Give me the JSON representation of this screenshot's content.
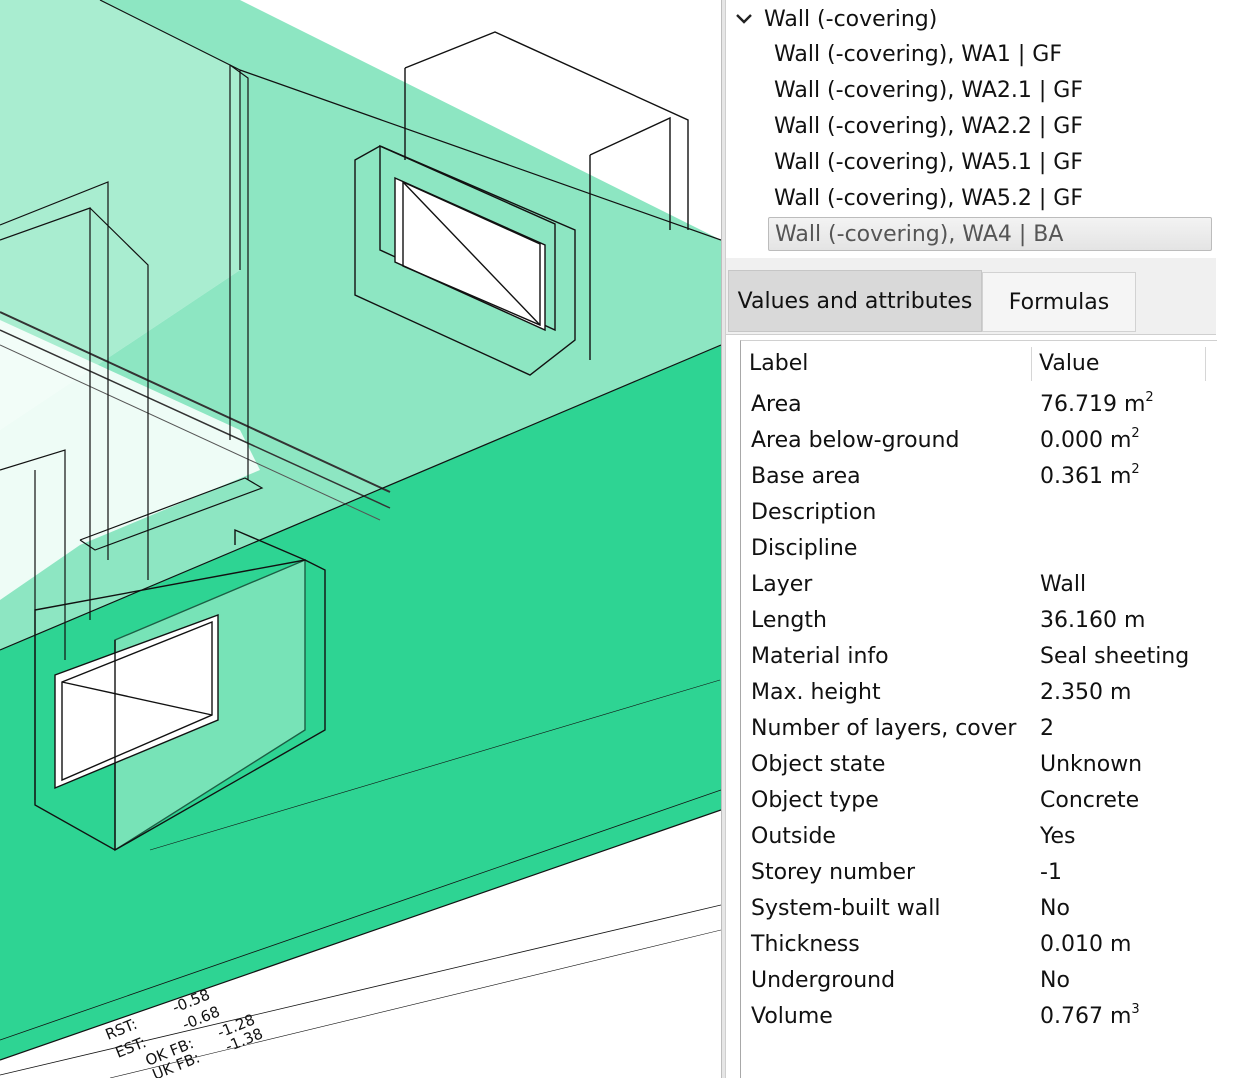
{
  "tree": {
    "root_label": "Wall (-covering)",
    "items": [
      {
        "label": "Wall (-covering), WA1 | GF",
        "selected": false
      },
      {
        "label": "Wall (-covering), WA2.1 | GF",
        "selected": false
      },
      {
        "label": "Wall (-covering), WA2.2 | GF",
        "selected": false
      },
      {
        "label": "Wall (-covering), WA5.1 | GF",
        "selected": false
      },
      {
        "label": "Wall (-covering), WA5.2 | GF",
        "selected": false
      },
      {
        "label": "Wall (-covering), WA4 | BA",
        "selected": true
      }
    ]
  },
  "tabs": {
    "values_label": "Values and attributes",
    "formulas_label": "Formulas"
  },
  "grid": {
    "header_label": "Label",
    "header_value": "Value",
    "rows": [
      {
        "label": "Area",
        "value": "76.719 m",
        "sup": "2"
      },
      {
        "label": "Area below-ground",
        "value": "0.000 m",
        "sup": "2"
      },
      {
        "label": "Base area",
        "value": "0.361 m",
        "sup": "2"
      },
      {
        "label": "Description",
        "value": "",
        "sup": ""
      },
      {
        "label": "Discipline",
        "value": "",
        "sup": ""
      },
      {
        "label": "Layer",
        "value": "Wall",
        "sup": ""
      },
      {
        "label": "Length",
        "value": "36.160 m",
        "sup": ""
      },
      {
        "label": "Material info",
        "value": "Seal sheeting",
        "sup": ""
      },
      {
        "label": "Max. height",
        "value": "2.350 m",
        "sup": ""
      },
      {
        "label": "Number of layers, cover",
        "value": "2",
        "sup": ""
      },
      {
        "label": "Object state",
        "value": "Unknown",
        "sup": ""
      },
      {
        "label": "Object type",
        "value": "Concrete",
        "sup": ""
      },
      {
        "label": "Outside",
        "value": "Yes",
        "sup": ""
      },
      {
        "label": "Storey number",
        "value": "-1",
        "sup": ""
      },
      {
        "label": "System-built wall",
        "value": "No",
        "sup": ""
      },
      {
        "label": "Thickness",
        "value": "0.010 m",
        "sup": ""
      },
      {
        "label": "Underground",
        "value": "No",
        "sup": ""
      },
      {
        "label": "Volume",
        "value": "0.767 m",
        "sup": "3"
      }
    ]
  },
  "viewport": {
    "annotations": [
      "RST: -0.58",
      "EST: -0.68",
      "OK FB: -1.28",
      "UK FB: -1.38"
    ],
    "colors": {
      "wall_solid": "#2ed493",
      "wall_transparent": "#8de6c2",
      "wall_light": "#a9edd0",
      "edge": "#1a1a1a"
    }
  }
}
